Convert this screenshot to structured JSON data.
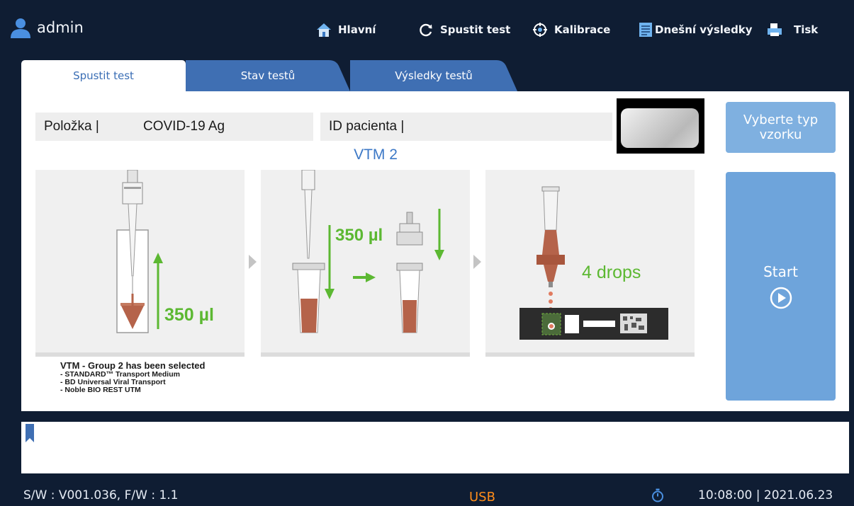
{
  "header": {
    "user": "admin",
    "nav": [
      {
        "label": "Hlavní",
        "icon": "home-icon"
      },
      {
        "label": "Spustit test",
        "icon": "refresh-icon"
      },
      {
        "label": "Kalibrace",
        "icon": "target-icon"
      },
      {
        "label": "Dnešní výsledky",
        "icon": "document-icon"
      },
      {
        "label": "Tisk",
        "icon": "printer-icon"
      }
    ]
  },
  "tabs": [
    {
      "label": "Spustit test",
      "active": true
    },
    {
      "label": "Stav testů",
      "active": false
    },
    {
      "label": "Výsledky testů",
      "active": false
    }
  ],
  "form": {
    "item_label": "Položka |",
    "item_value": "COVID-19 Ag",
    "patient_label": "ID pacienta |",
    "patient_value": ""
  },
  "sample_title": "VTM 2",
  "steps": [
    {
      "volume": "350 µl"
    },
    {
      "volume": "350 µl"
    },
    {
      "drops": "4 drops"
    }
  ],
  "group_note": {
    "headline": "VTM - Group 2 has been selected",
    "items": [
      "- STANDARD™ Transport Medium",
      "- BD Universal Viral Transport",
      "- Noble BIO REST UTM"
    ]
  },
  "buttons": {
    "select_sample": "Vyberte typ vzorku",
    "start": "Start"
  },
  "footer": {
    "firmware": "S/W : V001.036, F/W : 1.1",
    "usb": "USB",
    "datetime": "10:08:00 | 2021.06.23"
  },
  "colors": {
    "background": "#0f1d33",
    "tab_blue": "#3f6fb3",
    "accent_blue": "#3c78c6",
    "button_blue": "#7fb0e0",
    "instruction_green": "#5cb832",
    "usb_orange": "#ff8c1a"
  }
}
